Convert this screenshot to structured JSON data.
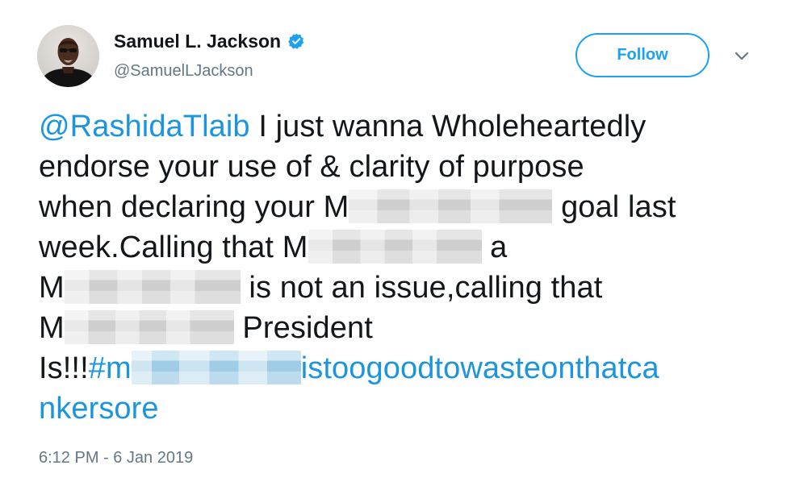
{
  "author": {
    "display_name": "Samuel L. Jackson",
    "handle": "@SamuelLJackson",
    "verified": true
  },
  "actions": {
    "follow_label": "Follow"
  },
  "tweet": {
    "mention": "@RashidaTlaib",
    "line1_rest": " I just wanna Wholeheartedly",
    "line2": "endorse your use of & clarity of purpose",
    "line3_start": "when declaring your M",
    "line3_end": " goal last",
    "line4_start": "week.Calling that M",
    "line4_end": " a",
    "line5_start": "M",
    "line5_end": " is not an issue,calling that",
    "line6_start": "M",
    "line6_end": " President",
    "line7_start": "Is!!!",
    "hashtag_start": "#m",
    "hashtag_end": "istoogoodtowasteonthatca",
    "hashtag_line8": "nkersore"
  },
  "timestamp": "6:12 PM - 6 Jan 2019",
  "colors": {
    "link": "#1b95e0",
    "follow_border": "#1da1f2",
    "secondary_text": "#657786",
    "primary_text": "#14171a"
  },
  "icons": {
    "verified": "verified-badge-icon",
    "more": "chevron-down-icon"
  }
}
